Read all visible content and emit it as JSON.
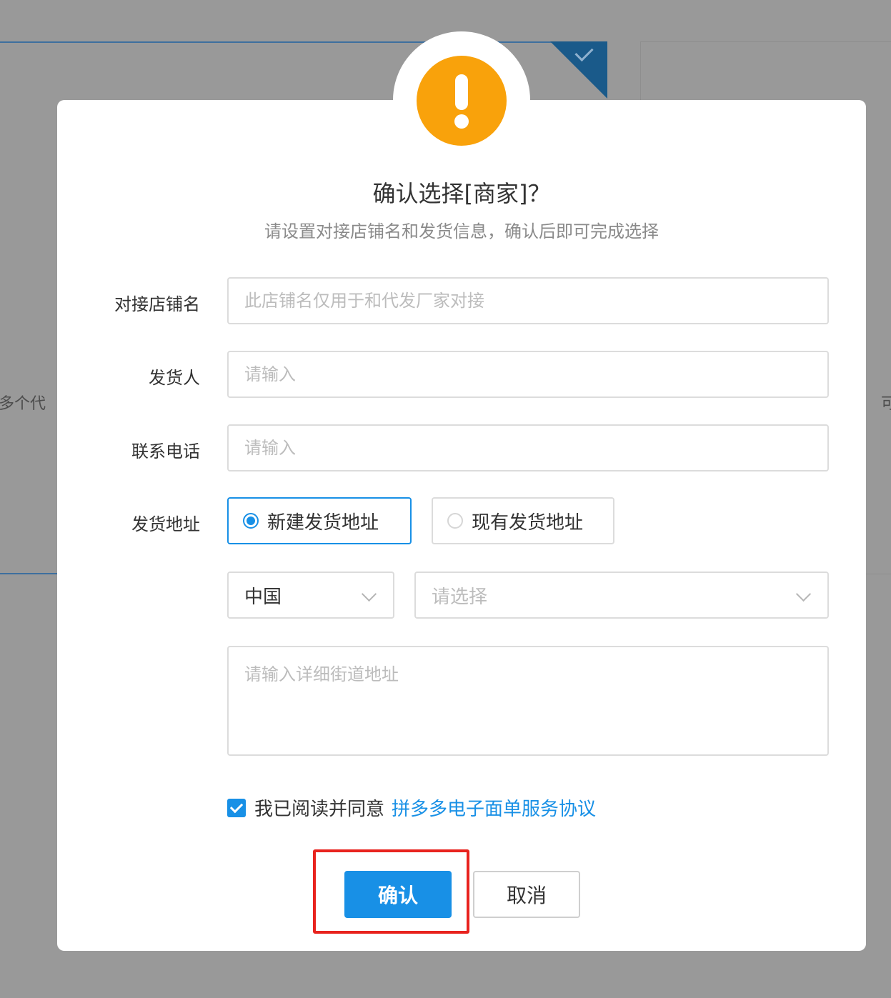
{
  "background": {
    "left_text": "多个代",
    "right_text": "可"
  },
  "dialog": {
    "icon": "warning-icon",
    "title": "确认选择[商家]？",
    "subtitle": "请设置对接店铺名和发货信息，确认后即可完成选择"
  },
  "form": {
    "shop_name": {
      "label": "对接店铺名",
      "placeholder": "此店铺名仅用于和代发厂家对接",
      "value": ""
    },
    "sender": {
      "label": "发货人",
      "placeholder": "请输入",
      "value": ""
    },
    "phone": {
      "label": "联系电话",
      "placeholder": "请输入",
      "value": ""
    },
    "address": {
      "label": "发货地址",
      "options": [
        {
          "label": "新建发货地址",
          "selected": true
        },
        {
          "label": "现有发货地址",
          "selected": false
        }
      ],
      "country": "中国",
      "region_placeholder": "请选择",
      "detail_placeholder": "请输入详细街道地址"
    }
  },
  "agreement": {
    "checked": true,
    "text": "我已阅读并同意",
    "link": "拼多多电子面单服务协议"
  },
  "buttons": {
    "confirm": "确认",
    "cancel": "取消"
  },
  "colors": {
    "primary": "#1890e6",
    "warning": "#f9a20b",
    "highlight": "#e8231e"
  }
}
